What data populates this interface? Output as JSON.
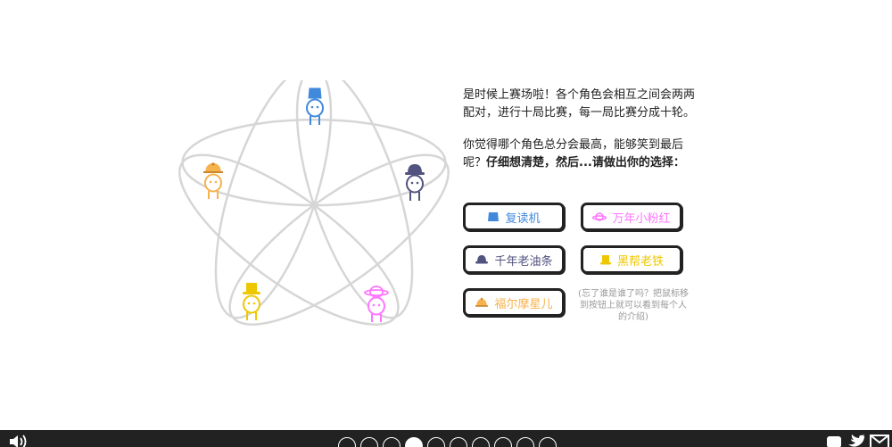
{
  "narration": {
    "para1": "是时候上赛场啦！各个角色会相互之间会两两配对，进行十局比赛，每一局比赛分成十轮。",
    "para2_normal": "你觉得哪个角色总分会最高，能够笑到最后呢？",
    "para2_bold": "仔细想清楚，然后...请做出你的选择："
  },
  "choices": [
    {
      "key": "copycat",
      "label": "复读机",
      "color": "#4089DD",
      "icon": "fez-hat-icon"
    },
    {
      "key": "cheater",
      "label": "万年小粉红",
      "color": "#FF75FF",
      "icon": "saturn-hat-icon"
    },
    {
      "key": "cooperator",
      "label": "千年老油条",
      "color": "#52537F",
      "icon": "bowler-hat-icon"
    },
    {
      "key": "grudger",
      "label": "黑帮老铁",
      "color": "#EFC701",
      "icon": "tophat-icon"
    },
    {
      "key": "detective",
      "label": "福尔摩星儿",
      "color": "#F6B24C",
      "icon": "deerstalker-hat-icon"
    }
  ],
  "hint": "(忘了谁是谁了吗？把鼠标移到按钮上就可以看到每个人的介绍)",
  "colors": {
    "copycat": "#4089DD",
    "cooperator": "#52537F",
    "cheater": "#FF75FF",
    "grudger": "#EFC701",
    "detective": "#F6B24C",
    "ring": "#d6d6d6",
    "footer": "#222222"
  },
  "footer": {
    "slides_total": 10,
    "active_slide": 4
  }
}
